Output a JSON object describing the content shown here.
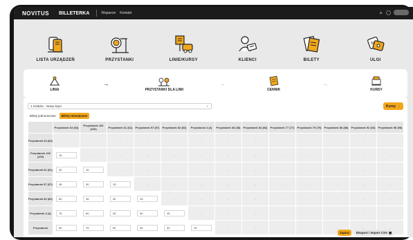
{
  "topbar": {
    "brand": "NOVITUS",
    "app": "BILLETERKA",
    "links": [
      "Wsparcie",
      "Kontakt"
    ]
  },
  "mainmenu": [
    {
      "label": "LISTA URZĄDZEŃ",
      "icon": "devices-icon"
    },
    {
      "label": "PRZYSTANKI",
      "icon": "bus-stop-icon"
    },
    {
      "label": "LINIE/KURSY",
      "icon": "bus-route-icon"
    },
    {
      "label": "KLIENCI",
      "icon": "clients-icon"
    },
    {
      "label": "BILETY",
      "icon": "tickets-icon"
    },
    {
      "label": "ULGI",
      "icon": "discount-icon"
    }
  ],
  "steps": {
    "linia": "LINIA",
    "przystanki": "PRZYSTANKI DLA LINII",
    "cennik": "CENNIK",
    "kursy": "KURSY"
  },
  "route_select": "1 Kraków - Nowy Sącz",
  "kursy_button": "Kursy",
  "tabs": [
    "Bilety jednorazowe",
    "Bilety miesięczne"
  ],
  "grid": {
    "columns": [
      "Przystanek 63 (63)",
      "Przystanek 100 (100)",
      "Przystanek 61 (61)",
      "Przystanek 57 (57)",
      "Przystanek 82 (82)",
      "Przystanek 4 (4)",
      "Przystanek 38 (38)",
      "Przystanek 84 (84)",
      "Przystanek 77 (77)",
      "Przystanek 79 (79)",
      "Przystanek 88 (88)",
      "Przystanek 92 (92)",
      "Przystanek 98 (98)"
    ],
    "rows": [
      {
        "label": "Przystanek 63 (63)",
        "values": []
      },
      {
        "label": "Przystanek 100 (100)",
        "values": [
          "15"
        ]
      },
      {
        "label": "Przystanek 61 (61)",
        "values": [
          "30",
          "15"
        ]
      },
      {
        "label": "Przystanek 57 (57)",
        "values": [
          "45",
          "30",
          "15"
        ]
      },
      {
        "label": "Przystanek 82 (82)",
        "values": [
          "60",
          "45",
          "30",
          "15"
        ]
      },
      {
        "label": "Przystanek 4 (4)",
        "values": [
          "75",
          "60",
          "45",
          "30",
          "15"
        ]
      },
      {
        "label": "Przystanek",
        "values": [
          "90",
          "75",
          "60",
          "45",
          "30",
          "15"
        ]
      }
    ],
    "empty": "-"
  },
  "buttons": {
    "save": "Zapisz",
    "export": "Eksport / Import CSV"
  }
}
